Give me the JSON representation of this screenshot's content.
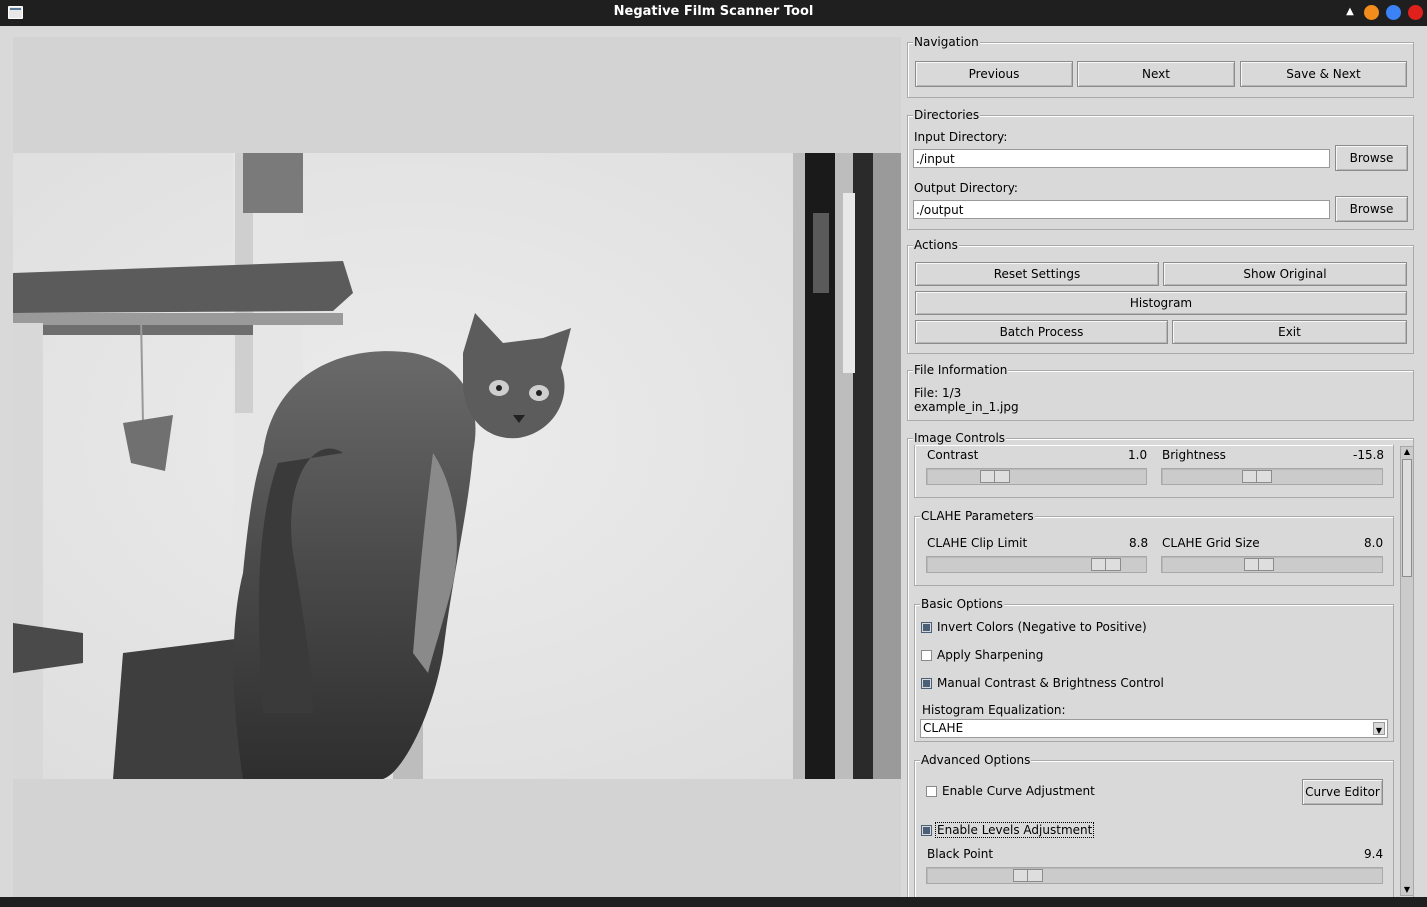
{
  "window": {
    "title": "Negative Film Scanner Tool"
  },
  "navigation": {
    "title": "Navigation",
    "previous": "Previous",
    "next": "Next",
    "save_next": "Save & Next"
  },
  "directories": {
    "title": "Directories",
    "input_label": "Input Directory:",
    "input_value": "./input",
    "output_label": "Output Directory:",
    "output_value": "./output",
    "browse": "Browse"
  },
  "actions": {
    "title": "Actions",
    "reset": "Reset Settings",
    "show_original": "Show Original",
    "histogram": "Histogram",
    "batch": "Batch Process",
    "exit": "Exit"
  },
  "file_info": {
    "title": "File Information",
    "index": "File: 1/3",
    "name": "example_in_1.jpg"
  },
  "image_controls": {
    "title": "Image Controls",
    "contrast_label": "Contrast",
    "contrast_value": "1.0",
    "contrast_level": 0.28,
    "brightness_label": "Brightness",
    "brightness_value": "-15.8",
    "brightness_level": 0.42
  },
  "clahe": {
    "title": "CLAHE Parameters",
    "clip_label": "CLAHE Clip Limit",
    "clip_value": "8.8",
    "clip_level": 0.87,
    "grid_label": "CLAHE Grid Size",
    "grid_value": "8.0",
    "grid_level": 0.43
  },
  "basic": {
    "title": "Basic Options",
    "invert": "Invert Colors (Negative to Positive)",
    "invert_checked": true,
    "sharpen": "Apply Sharpening",
    "sharpen_checked": false,
    "manual": "Manual Contrast & Brightness Control",
    "manual_checked": true,
    "histeq_label": "Histogram Equalization:",
    "histeq_value": "CLAHE"
  },
  "advanced": {
    "title": "Advanced Options",
    "curve": "Enable Curve Adjustment",
    "curve_checked": false,
    "curve_editor": "Curve Editor",
    "levels": "Enable Levels Adjustment",
    "levels_checked": true,
    "black_point_label": "Black Point",
    "black_point_value": "9.4",
    "black_point_level": 0.2
  },
  "icons": {
    "titlebar_shade": "triangle-up-icon",
    "minimize": "#f28c1c",
    "maximize": "#3b82f6",
    "close": "#e0201b"
  }
}
